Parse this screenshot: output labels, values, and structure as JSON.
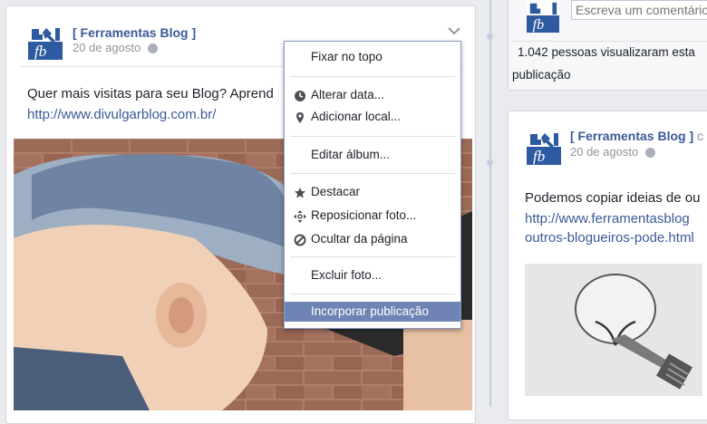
{
  "post_left": {
    "page_name": "[ Ferramentas Blog ]",
    "date": "20 de agosto",
    "text": "Quer mais visitas para seu Blog? Aprend",
    "link": "http://www.divulgarblog.com.br/"
  },
  "menu": {
    "items": [
      {
        "label": "Fixar no topo",
        "icon": ""
      },
      {
        "label": "Alterar data...",
        "icon": "clock-icon"
      },
      {
        "label": "Adicionar local...",
        "icon": "location-pin-icon"
      },
      {
        "label": "Editar álbum...",
        "icon": ""
      },
      {
        "label": "Destacar",
        "icon": "star-icon"
      },
      {
        "label": "Reposicionar foto...",
        "icon": "move-arrows-icon"
      },
      {
        "label": "Ocultar da página",
        "icon": "block-icon"
      },
      {
        "label": "Excluir foto...",
        "icon": ""
      },
      {
        "label": "Incorporar publicação",
        "icon": "",
        "highlighted": true
      }
    ]
  },
  "right_top": {
    "comment_placeholder": "Escreva um comentário...",
    "views_line1": "1.042 pessoas visualizaram esta",
    "views_line2": "publicação"
  },
  "post_right": {
    "page_name": "[ Ferramentas Blog ]",
    "page_name_suffix": "c",
    "date": "20 de agosto",
    "text": "Podemos copiar ideias de ou",
    "link1": "http://www.ferramentasblog",
    "link2": "outros-blogueiros-pode.html"
  },
  "colors": {
    "link": "#3b5998",
    "menu_highlight": "#6d84b4",
    "background": "#e9ebee"
  }
}
